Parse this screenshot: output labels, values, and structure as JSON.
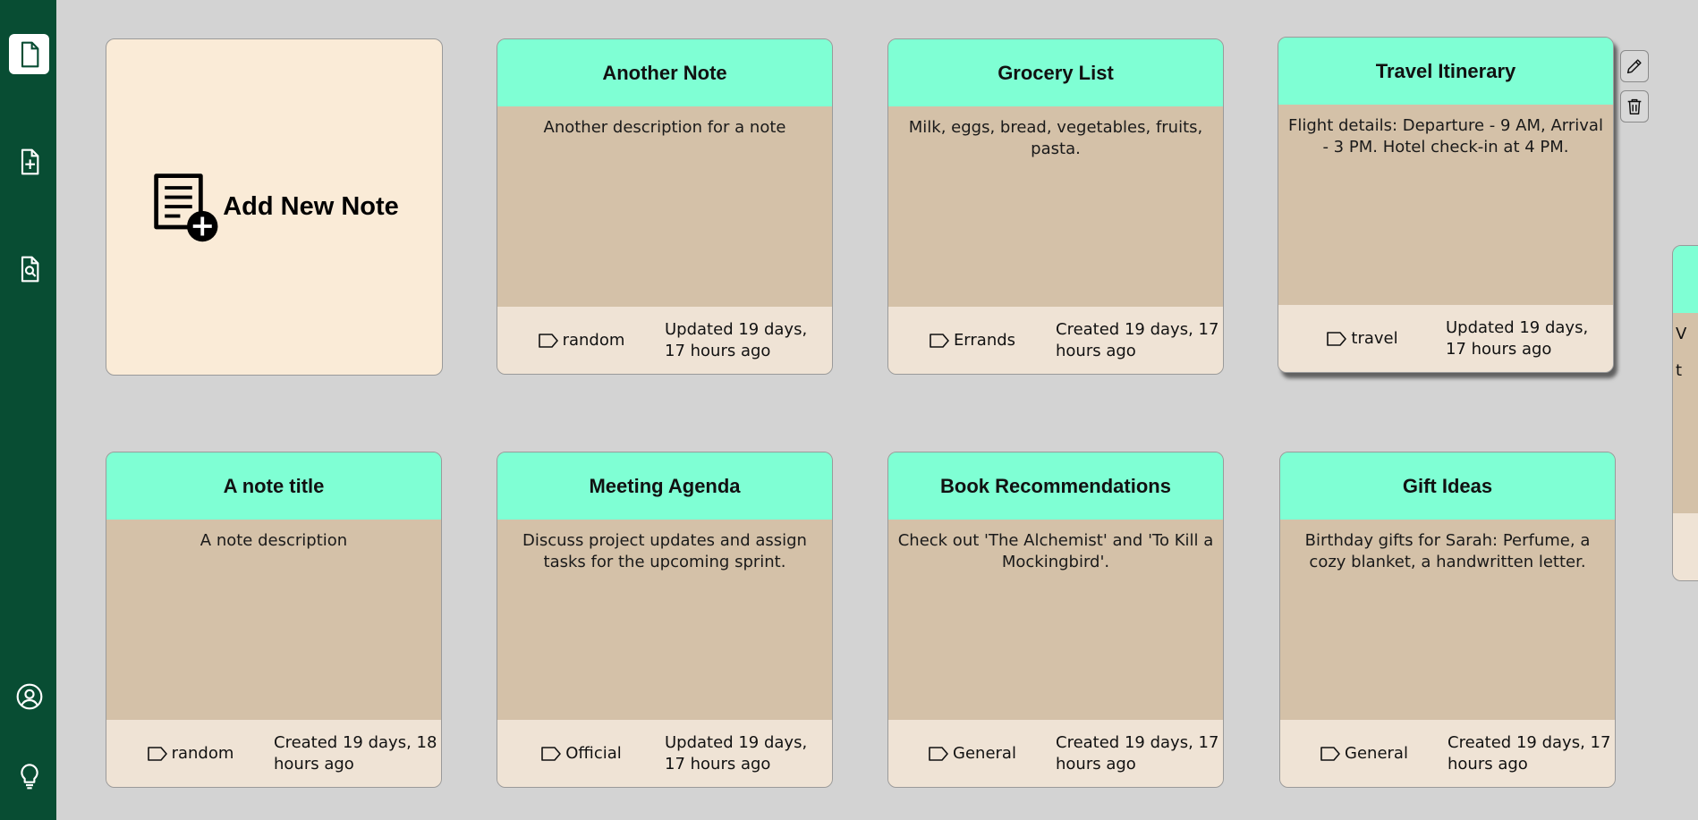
{
  "sidebar": {
    "items": [
      {
        "name": "notes-icon"
      },
      {
        "name": "new-note-icon"
      },
      {
        "name": "search-notes-icon"
      },
      {
        "name": "profile-icon"
      },
      {
        "name": "theme-lightbulb-icon"
      }
    ],
    "color": "#084d33"
  },
  "add_card": {
    "label": "Add New Note",
    "icon": "add-note-icon",
    "color": "#faebd7"
  },
  "colors": {
    "header": "#7fffd4",
    "body": "#d4c1a8",
    "footer": "#efe3d5",
    "background": "#d3d3d3"
  },
  "notes": [
    {
      "title": "Another Note",
      "description": "Another description for a note",
      "tag": "random",
      "time": "Updated 19 days, 17 hours ago"
    },
    {
      "title": "Grocery List",
      "description": "Milk, eggs, bread, vegetables, fruits, pasta.",
      "tag": "Errands",
      "time": "Created 19 days, 17 hours ago"
    },
    {
      "title": "Travel Itinerary",
      "description": "Flight details: Departure - 9 AM, Arrival - 3 PM. Hotel check-in at 4 PM.",
      "tag": "travel",
      "time": "Updated 19 days, 17 hours ago"
    },
    {
      "title": "A note title",
      "description": "A note description",
      "tag": "random",
      "time": "Created 19 days, 18 hours ago"
    },
    {
      "title": "Meeting Agenda",
      "description": "Discuss project updates and assign tasks for the upcoming sprint.",
      "tag": "Official",
      "time": "Updated 19 days, 17 hours ago"
    },
    {
      "title": "Book Recommendations",
      "description": "Check out 'The Alchemist' and 'To Kill a Mockingbird'.",
      "tag": "General",
      "time": "Created 19 days, 17 hours ago"
    },
    {
      "title": "Gift Ideas",
      "description": "Birthday gifts for Sarah: Perfume, a cozy blanket, a handwritten letter.",
      "tag": "General",
      "time": "Created 19 days, 17 hours ago"
    }
  ],
  "card_actions": {
    "edit_icon": "pencil-icon",
    "delete_icon": "trash-icon"
  },
  "partial_card": {
    "line1": "V",
    "line2": "t"
  }
}
